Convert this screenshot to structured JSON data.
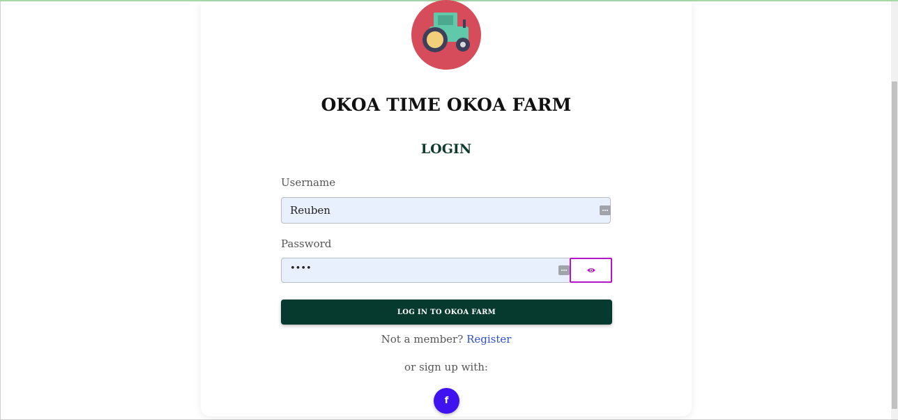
{
  "app": {
    "brand_title": "OKOA TIME OKOA FARM",
    "logo_icon": "tractor-icon"
  },
  "login": {
    "heading": "LOGIN",
    "username": {
      "label": "Username",
      "value": "Reuben"
    },
    "password": {
      "label": "Password",
      "value": "••••",
      "toggle_icon": "eye-icon"
    },
    "submit_label": "LOG IN TO OKOA FARM",
    "member_prompt": "Not a member?",
    "register_label": "Register",
    "social_prompt": "or sign up with:",
    "social": [
      {
        "icon": "facebook-icon",
        "glyph": "f"
      }
    ]
  },
  "colors": {
    "primary": "#063a2f",
    "logo_bg": "#d64c5a",
    "input_bg": "#e8f0fe",
    "link": "#2c4fd6",
    "facebook": "#3f12f0",
    "toggle_border": "#b515c9"
  }
}
